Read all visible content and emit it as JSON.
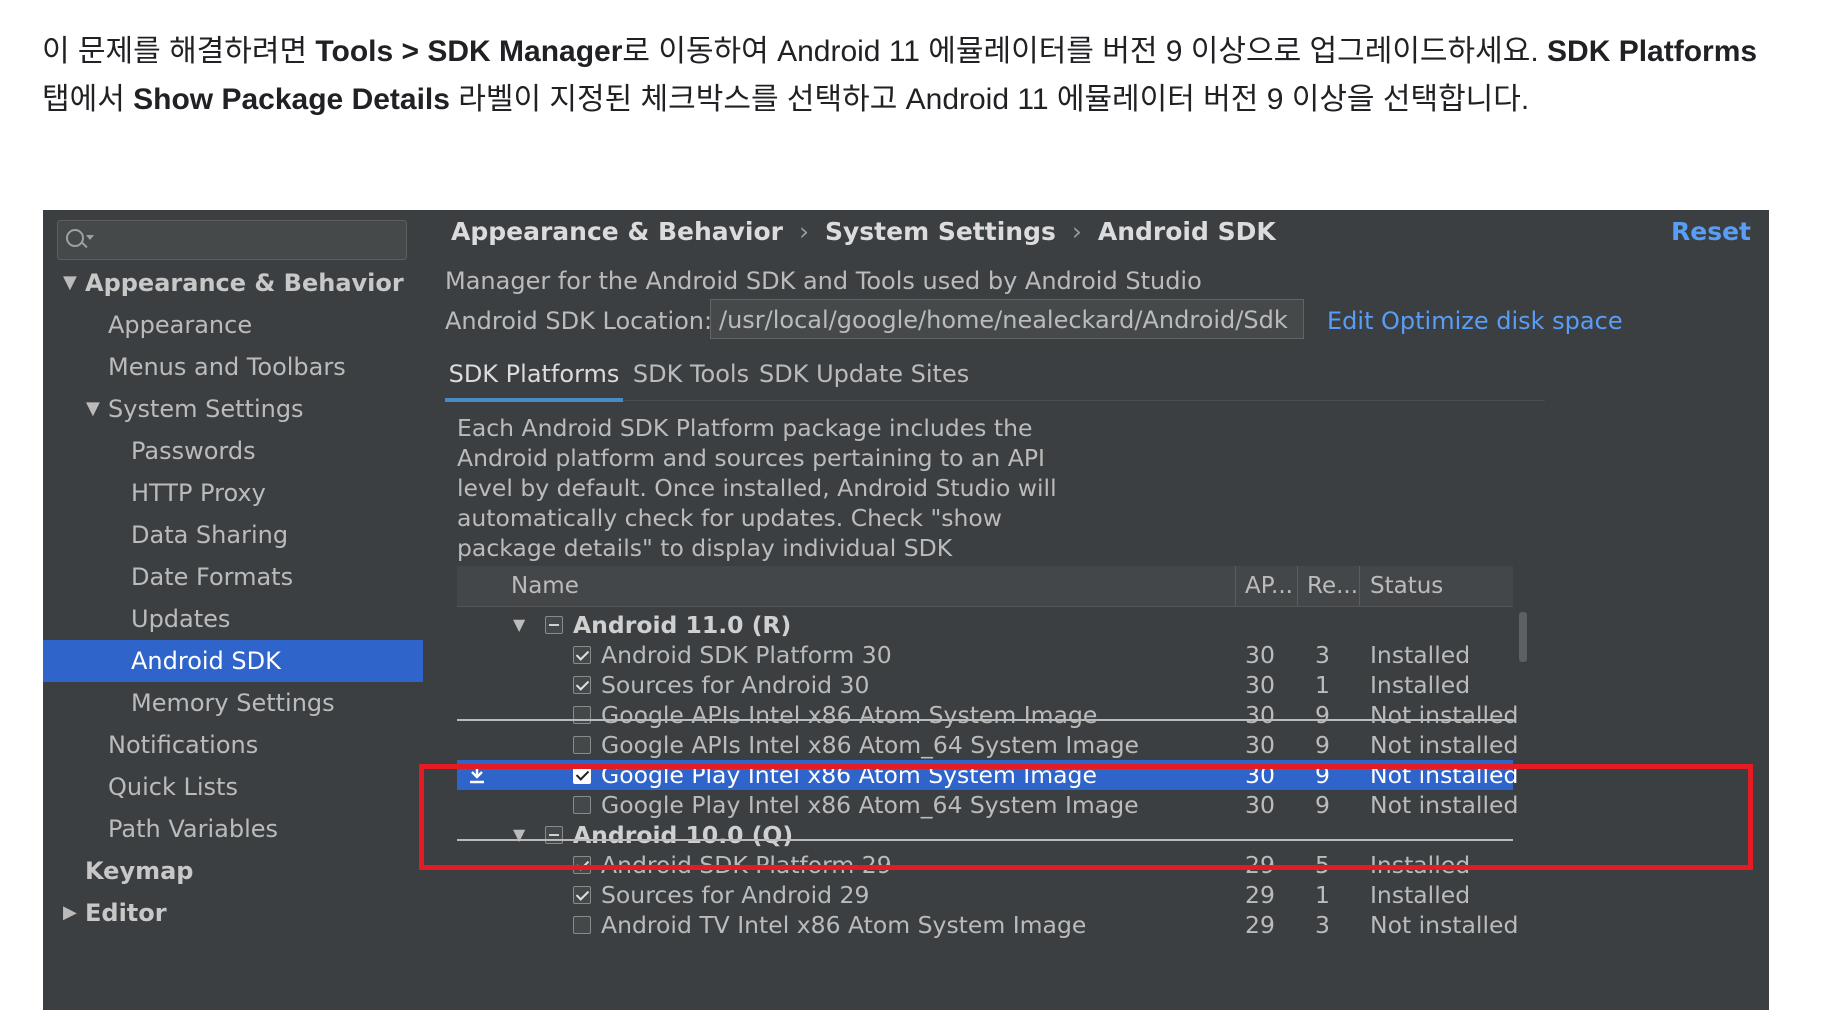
{
  "intro": {
    "t1": "이 문제를 해결하려면 ",
    "b1": "Tools > SDK Manager",
    "t2": "로 이동하여 Android 11 에뮬레이터를 버전 9 이상으로 업그레이드하세요. ",
    "b2": "SDK Platforms",
    "t3": " 탭에서 ",
    "b3": "Show Package Details",
    "t4": " 라벨이 지정된 체크박스를 선택하고 Android 11 에뮬레이터 버전 9 이상을 선택합니다."
  },
  "sidebar": {
    "search_placeholder": "",
    "items": [
      {
        "label": "Appearance & Behavior",
        "level": 0,
        "bold": true,
        "expanded": true
      },
      {
        "label": "Appearance",
        "level": 1
      },
      {
        "label": "Menus and Toolbars",
        "level": 1
      },
      {
        "label": "System Settings",
        "level": 1,
        "expanded": true
      },
      {
        "label": "Passwords",
        "level": 2
      },
      {
        "label": "HTTP Proxy",
        "level": 2
      },
      {
        "label": "Data Sharing",
        "level": 2
      },
      {
        "label": "Date Formats",
        "level": 2
      },
      {
        "label": "Updates",
        "level": 2
      },
      {
        "label": "Android SDK",
        "level": 2,
        "selected": true
      },
      {
        "label": "Memory Settings",
        "level": 2
      },
      {
        "label": "Notifications",
        "level": 1
      },
      {
        "label": "Quick Lists",
        "level": 1
      },
      {
        "label": "Path Variables",
        "level": 1
      },
      {
        "label": "Keymap",
        "level": 0,
        "bold": true
      },
      {
        "label": "Editor",
        "level": 0,
        "bold": true
      }
    ]
  },
  "breadcrumb": {
    "items": [
      "Appearance & Behavior",
      "System Settings",
      "Android SDK"
    ],
    "separator": "›"
  },
  "reset_label": "Reset",
  "description": "Manager for the Android SDK and Tools used by Android Studio",
  "location": {
    "label": "Android SDK Location:",
    "value": "/usr/local/google/home/nealeckard/Android/Sdk",
    "edit_label": "Edit",
    "optimize_label": "Optimize disk space"
  },
  "tabs": [
    {
      "label": "SDK Platforms",
      "active": true
    },
    {
      "label": "SDK Tools"
    },
    {
      "label": "SDK Update Sites"
    }
  ],
  "platforms_description": "Each Android SDK Platform package includes the\nAndroid platform and sources pertaining to an API\nlevel by default. Once installed, Android Studio will\nautomatically check for updates. Check \"show\npackage details\" to display individual SDK\ncomponents.",
  "table": {
    "columns": [
      "Name",
      "AP...",
      "Re...",
      "Status"
    ],
    "rows": [
      {
        "type": "group",
        "name": "Android 11.0 (R)",
        "expanded": true
      },
      {
        "type": "item",
        "name": "Android SDK Platform 30",
        "api": "30",
        "rev": "3",
        "status": "Installed",
        "checked": true
      },
      {
        "type": "item",
        "name": "Sources for Android 30",
        "api": "30",
        "rev": "1",
        "status": "Installed",
        "checked": true
      },
      {
        "type": "item",
        "name": "Google APIs Intel x86 Atom System Image",
        "api": "30",
        "rev": "9",
        "status": "Not installed",
        "checked": false,
        "clipped": true
      },
      {
        "type": "item",
        "name": "Google APIs Intel x86 Atom_64 System Image",
        "api": "30",
        "rev": "9",
        "status": "Not installed",
        "checked": false
      },
      {
        "type": "item",
        "name": "Google Play Intel x86 Atom System Image",
        "api": "30",
        "rev": "9",
        "status": "Not installed",
        "checked": true,
        "selected": true,
        "download": true
      },
      {
        "type": "item",
        "name": "Google Play Intel x86 Atom_64 System Image",
        "api": "30",
        "rev": "9",
        "status": "Not installed",
        "checked": false
      },
      {
        "type": "group",
        "name": "Android 10.0 (Q)",
        "expanded": true,
        "clipped": true
      },
      {
        "type": "item",
        "name": "Android SDK Platform 29",
        "api": "29",
        "rev": "5",
        "status": "Installed",
        "checked": true
      },
      {
        "type": "item",
        "name": "Sources for Android 29",
        "api": "29",
        "rev": "1",
        "status": "Installed",
        "checked": true
      },
      {
        "type": "item",
        "name": "Android TV Intel x86 Atom System Image",
        "api": "29",
        "rev": "3",
        "status": "Not installed",
        "checked": false
      }
    ]
  },
  "colors": {
    "selection": "#2f65ca",
    "link": "#589df6",
    "highlight_box": "#e31b22"
  }
}
